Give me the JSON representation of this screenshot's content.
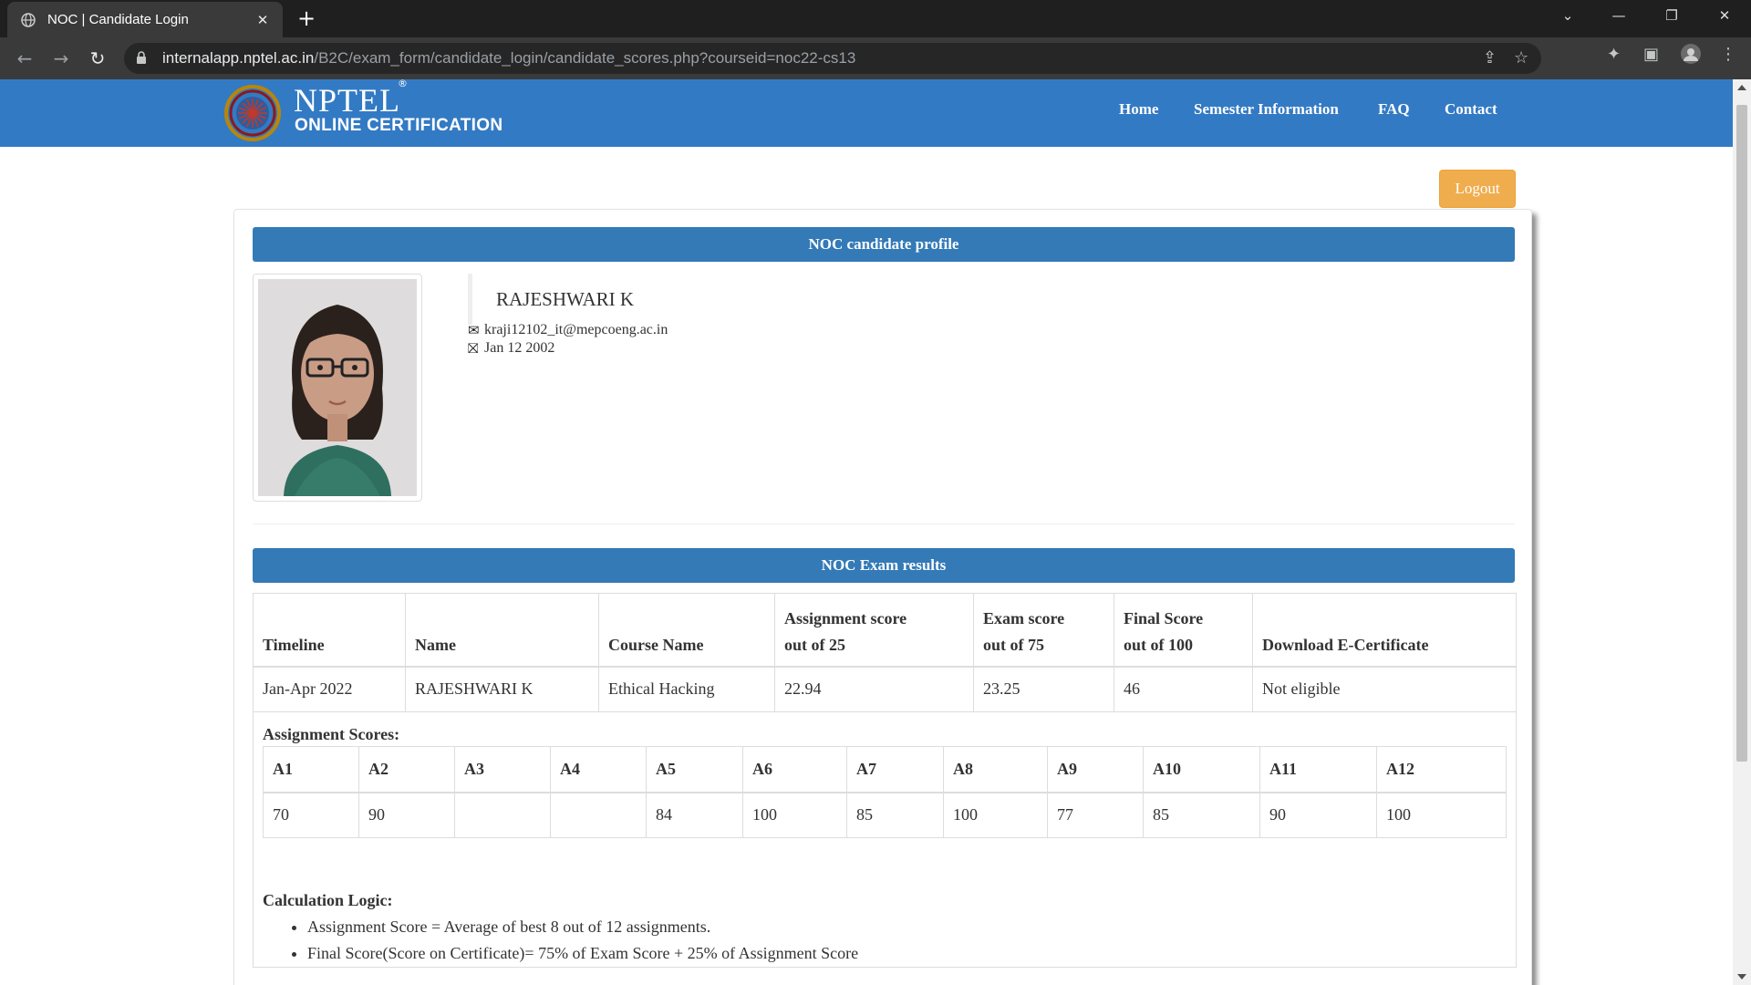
{
  "browser": {
    "tab_title": "NOC | Candidate Login",
    "url_host": "internalapp.nptel.ac.in",
    "url_path": "/B2C/exam_form/candidate_login/candidate_scores.php?courseid=noc22-cs13"
  },
  "header": {
    "brand_name": "NPTEL",
    "brand_reg": "®",
    "brand_sub": "ONLINE CERTIFICATION",
    "nav": [
      "Home",
      "Semester Information",
      "FAQ",
      "Contact"
    ]
  },
  "logout_label": "Logout",
  "profile": {
    "section_title": "NOC candidate profile",
    "name": "RAJESHWARI K",
    "email": "kraji12102_it@mepcoeng.ac.in",
    "dob": "Jan 12 2002"
  },
  "results": {
    "section_title": "NOC Exam results",
    "headers": {
      "timeline": "Timeline",
      "name": "Name",
      "course": "Course Name",
      "assignment_1": "Assignment score",
      "assignment_2": "out of 25",
      "exam_1": "Exam score",
      "exam_2": "out of 75",
      "final_1": "Final Score",
      "final_2": "out of 100",
      "download": "Download E-Certificate"
    },
    "row": {
      "timeline": "Jan-Apr 2022",
      "name": "RAJESHWARI K",
      "course": "Ethical Hacking",
      "assignment": "22.94",
      "exam": "23.25",
      "final": "46",
      "download": "Not eligible"
    }
  },
  "assignments": {
    "title": "Assignment Scores:",
    "labels": [
      "A1",
      "A2",
      "A3",
      "A4",
      "A5",
      "A6",
      "A7",
      "A8",
      "A9",
      "A10",
      "A11",
      "A12"
    ],
    "scores": [
      "70",
      "90",
      "",
      "",
      "84",
      "100",
      "85",
      "100",
      "77",
      "85",
      "90",
      "100"
    ]
  },
  "calculation": {
    "title": "Calculation Logic:",
    "items": [
      "Assignment Score = Average of best 8 out of 12 assignments.",
      "Final Score(Score on Certificate)= 75% of Exam Score + 25% of Assignment Score"
    ]
  },
  "colors": {
    "header_blue": "#337ac4",
    "section_blue": "#337ab7",
    "logout_orange": "#f0ad4e"
  },
  "icons": {
    "email": "envelope-icon",
    "dob": "gift-icon"
  }
}
